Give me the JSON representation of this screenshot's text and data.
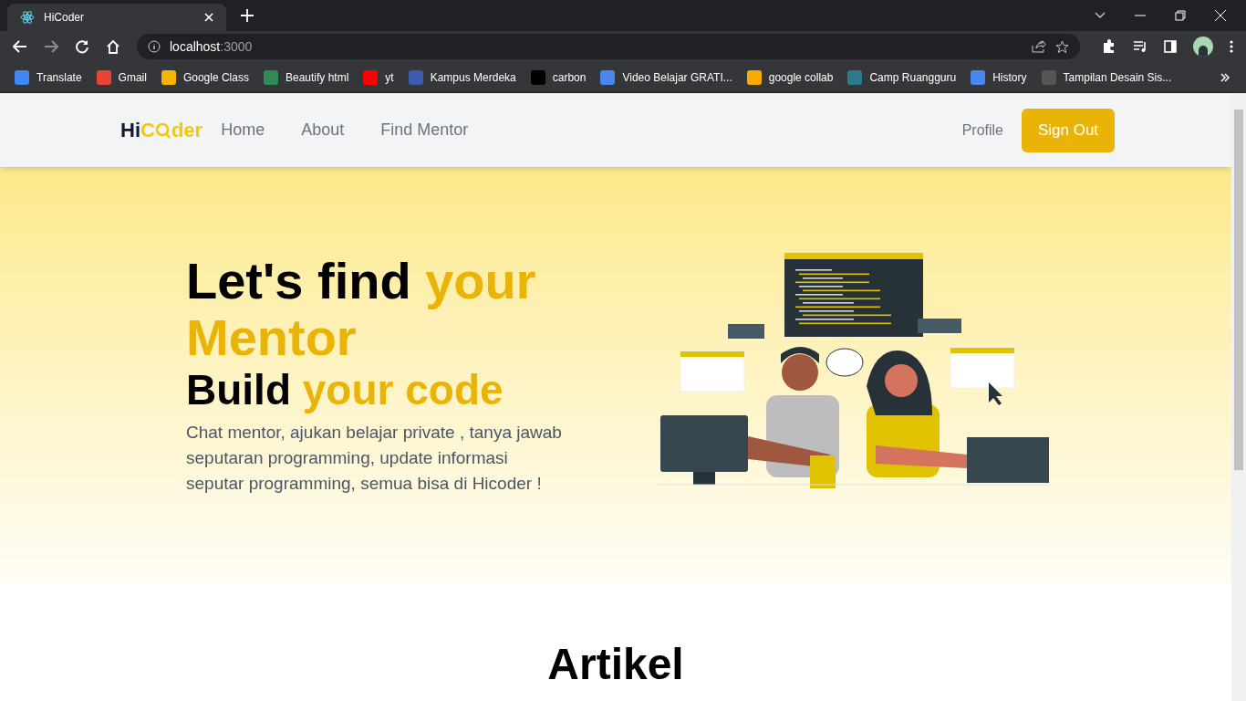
{
  "browser": {
    "tab": {
      "title": "HiCoder"
    },
    "address": {
      "host": "localhost",
      "port": ":3000"
    },
    "bookmarks": [
      {
        "label": "Translate",
        "color": "#4285f4"
      },
      {
        "label": "Gmail",
        "color": "#ea4335"
      },
      {
        "label": "Google Class",
        "color": "#f4b400"
      },
      {
        "label": "Beautify html",
        "color": "#2e8b57"
      },
      {
        "label": "yt",
        "color": "#ff0000"
      },
      {
        "label": "Kampus Merdeka",
        "color": "#3b5bab"
      },
      {
        "label": "carbon",
        "color": "#000000"
      },
      {
        "label": "Video Belajar GRATI...",
        "color": "#4a86f0"
      },
      {
        "label": "google collab",
        "color": "#f9ab00"
      },
      {
        "label": "Camp Ruangguru",
        "color": "#2c7a8c"
      },
      {
        "label": "History",
        "color": "#4a86f0"
      },
      {
        "label": "Tampilan Desain Sis...",
        "color": "#555555"
      }
    ]
  },
  "navbar": {
    "logo": {
      "dark": "Hi",
      "accent_before": "C",
      "accent_after": "der"
    },
    "links": [
      {
        "label": "Home"
      },
      {
        "label": "About"
      },
      {
        "label": "Find Mentor"
      }
    ],
    "profile": "Profile",
    "sign_out": "Sign Out"
  },
  "hero": {
    "title": [
      {
        "text": "Let's find ",
        "accent": false
      },
      {
        "text": "your Mentor",
        "accent": true
      }
    ],
    "subtitle": [
      {
        "text": "Build ",
        "accent": false
      },
      {
        "text": "your code",
        "accent": true
      }
    ],
    "description": "Chat mentor, ajukan belajar private , tanya jawab seputaran programming, update informasi seputar programming, semua bisa di Hicoder !"
  },
  "articles": {
    "heading": "Artikel"
  }
}
